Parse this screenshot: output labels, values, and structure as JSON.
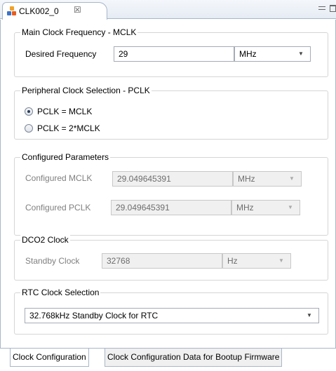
{
  "editor_tab": {
    "title": "CLK002_0",
    "close_glyph": "☒",
    "icon": "component-icon"
  },
  "groups": {
    "main_clock": {
      "legend": "Main Clock Frequency - MCLK",
      "desired_label": "Desired Frequency",
      "desired_value": "29",
      "desired_unit": "MHz"
    },
    "peripheral_clock": {
      "legend": "Peripheral Clock Selection - PCLK",
      "options": [
        {
          "label": "PCLK = MCLK",
          "selected": true
        },
        {
          "label": "PCLK = 2*MCLK",
          "selected": false
        }
      ]
    },
    "configured": {
      "legend": "Configured Parameters",
      "mclk_label": "Configured MCLK",
      "mclk_value": "29.049645391",
      "mclk_unit": "MHz",
      "pclk_label": "Configured PCLK",
      "pclk_value": "29.049645391",
      "pclk_unit": "MHz"
    },
    "dco2": {
      "legend": "DCO2 Clock",
      "standby_label": "Standby Clock",
      "standby_value": "32768",
      "standby_unit": "Hz"
    },
    "rtc": {
      "legend": "RTC Clock Selection",
      "selected": "32.768kHz Standby Clock for RTC"
    }
  },
  "bottom_tabs": [
    {
      "label": "Clock Configuration",
      "active": true
    },
    {
      "label": "Clock Configuration Data for Bootup Firmware",
      "active": false
    }
  ],
  "colors": {
    "border": "#a9b6c8",
    "disabled_text": "#808080",
    "disabled_field": "#f0f0f0"
  }
}
